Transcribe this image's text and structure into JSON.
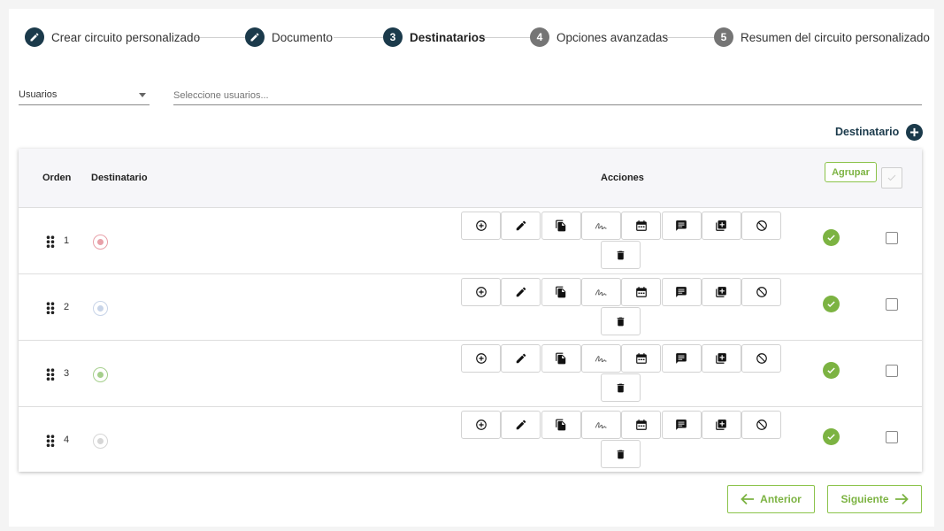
{
  "stepper": {
    "steps": [
      {
        "number": "",
        "icon": "pencil-icon",
        "label": "Crear circuito personalizado",
        "state": "done"
      },
      {
        "number": "",
        "icon": "pencil-icon",
        "label": "Documento",
        "state": "done"
      },
      {
        "number": "3",
        "label": "Destinatarios",
        "state": "active"
      },
      {
        "number": "4",
        "label": "Opciones avanzadas",
        "state": "pending"
      },
      {
        "number": "5",
        "label": "Resumen del circuito personalizado",
        "state": "pending"
      }
    ]
  },
  "filter": {
    "select_value": "Usuarios",
    "search_placeholder": "Seleccione usuarios..."
  },
  "add_recipient": {
    "label": "Destinatario",
    "icon": "plus-circle-icon"
  },
  "table": {
    "headers": {
      "order": "Orden",
      "recipient": "Destinatario",
      "actions": "Acciones"
    },
    "group_button": "Agrupar",
    "action_icons": [
      "add-circle-icon",
      "pencil-icon",
      "copy-document-icon",
      "signature-icon",
      "calendar-icon",
      "comment-icon",
      "library-add-icon",
      "block-icon",
      "delete-icon"
    ],
    "rows": [
      {
        "order": "1",
        "status_color": "#e8a0a8",
        "valid": true,
        "checked": false
      },
      {
        "order": "2",
        "status_color": "#c8d4e8",
        "valid": true,
        "checked": false
      },
      {
        "order": "3",
        "status_color": "#a5cf8c",
        "valid": true,
        "checked": false
      },
      {
        "order": "4",
        "status_color": "#d6d6d6",
        "valid": true,
        "checked": false
      }
    ]
  },
  "footer": {
    "prev": "Anterior",
    "next": "Siguiente"
  },
  "colors": {
    "primary_dark": "#1b3a4b",
    "accent_green": "#7cb342",
    "inactive_step": "#757575"
  }
}
